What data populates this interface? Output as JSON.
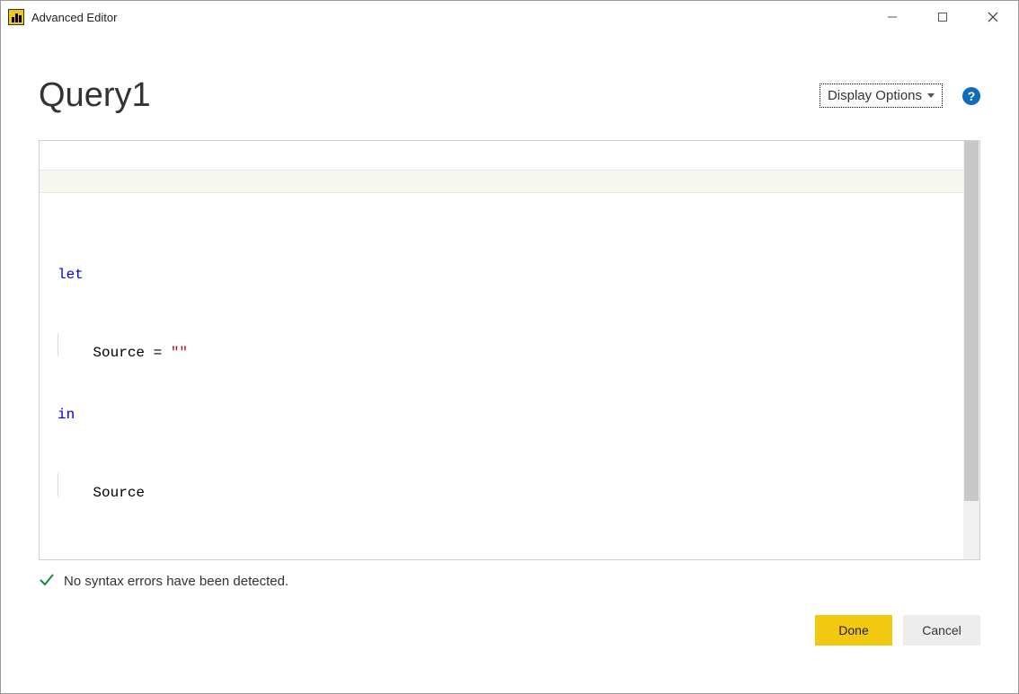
{
  "window": {
    "title": "Advanced Editor"
  },
  "header": {
    "query_name": "Query1",
    "display_options_label": "Display Options"
  },
  "code": {
    "line1_keyword": "let",
    "line2_var": "Source = ",
    "line2_string": "\"\"",
    "line3_keyword": "in",
    "line4_var": "Source",
    "highlighted_line_index": 1
  },
  "status": {
    "message": "No syntax errors have been detected."
  },
  "buttons": {
    "done": "Done",
    "cancel": "Cancel"
  }
}
